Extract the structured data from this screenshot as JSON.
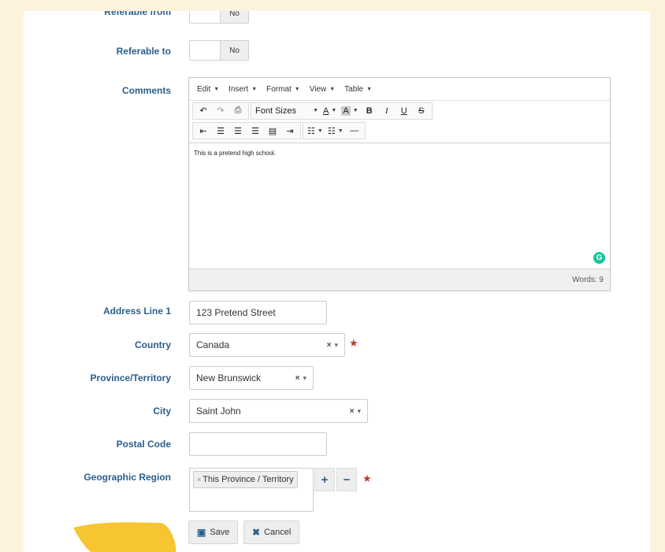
{
  "form": {
    "referable_from": {
      "label": "Referable from",
      "value": "No"
    },
    "referable_to": {
      "label": "Referable to",
      "value": "No"
    },
    "comments": {
      "label": "Comments",
      "menu": [
        "Edit",
        "Insert",
        "Format",
        "View",
        "Table"
      ],
      "font_sizes_label": "Font Sizes",
      "content": "This is a pretend high school.",
      "word_count": "Words: 9"
    },
    "address_line_1": {
      "label": "Address Line 1",
      "value": "123 Pretend Street"
    },
    "country": {
      "label": "Country",
      "value": "Canada"
    },
    "province": {
      "label": "Province/Territory",
      "value": "New Brunswick"
    },
    "city": {
      "label": "City",
      "value": "Saint John"
    },
    "postal_code": {
      "label": "Postal Code",
      "value": ""
    },
    "geographic_region": {
      "label": "Geographic Region",
      "tags": [
        "This Province / Territory"
      ]
    }
  },
  "buttons": {
    "save": "Save",
    "cancel": "Cancel"
  },
  "colors": {
    "background": "#fdf3dc",
    "label": "#2a5e8c",
    "required": "#c0392b",
    "grammarly": "#15c39a",
    "highlight_stroke": "#f6c531"
  },
  "icons": {
    "undo": "undo-icon",
    "redo": "redo-icon",
    "print": "print-icon",
    "save": "floppy-icon",
    "cancel": "x-icon",
    "grammarly": "grammarly-icon"
  }
}
